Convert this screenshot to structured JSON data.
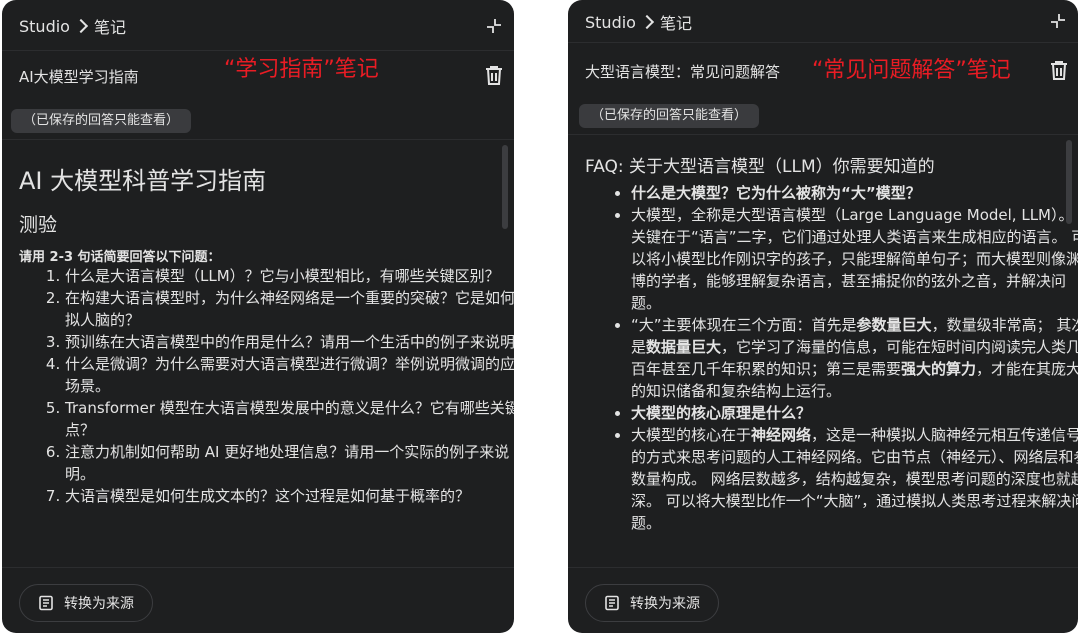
{
  "left": {
    "breadcrumb_root": "Studio",
    "breadcrumb_current": "笔记",
    "note_title": "AI大模型学习指南",
    "annotation": "“学习指南”笔记",
    "chip": "（已保存的回答只能查看）",
    "heading": "AI 大模型科普学习指南",
    "subheading": "测验",
    "instruction": "请用 2-3 句话简要回答以下问题：",
    "questions": [
      "什么是大语言模型（LLM）？它与小模型相比，有哪些关键区别？",
      "在构建大语言模型时，为什么神经网络是一个重要的突破？它是如何模拟人脑的？",
      "预训练在大语言模型中的作用是什么？请用一个生活中的例子来说明。",
      "什么是微调？为什么需要对大语言模型进行微调？举例说明微调的应用场景。",
      "Transformer 模型在大语言模型发展中的意义是什么？它有哪些关键特点？",
      "注意力机制如何帮助 AI 更好地处理信息？请用一个实际的例子来说明。",
      "大语言模型是如何生成文本的？这个过程是如何基于概率的？"
    ],
    "convert_label": "转换为来源"
  },
  "right": {
    "breadcrumb_root": "Studio",
    "breadcrumb_current": "笔记",
    "note_title": "大型语言模型：常见问题解答",
    "annotation": "“常见问题解答”笔记",
    "chip": "（已保存的回答只能查看）",
    "faq_title": "FAQ: 关于大型语言模型（LLM）你需要知道的",
    "q1": "什么是大模型？它为什么被称为“大”模型？",
    "a1": "大模型，全称是大型语言模型（Large Language Model, LLM）。 关键在于“语言”二字，它们通过处理人类语言来生成相应的语言。 可以将小模型比作刚识字的孩子，只能理解简单句子；而大模型则像渊博的学者，能够理解复杂语言，甚至捕捉你的弦外之音，并解决问题。",
    "a2_p1": "“大”主要体现在三个方面：首先是",
    "a2_b1": "参数量巨大",
    "a2_p2": "，数量级非常高； 其次是",
    "a2_b2": "数据量巨大",
    "a2_p3": "，它学习了海量的信息，可能在短时间内阅读完人类几百年甚至几千年积累的知识；第三是需要",
    "a2_b3": "强大的算力",
    "a2_p4": "，才能在其庞大的知识储备和复杂结构上运行。",
    "q2": "大模型的核心原理是什么？",
    "a3_p1": "大模型的核心在于",
    "a3_b1": "神经网络",
    "a3_p2": "，这是一种模拟人脑神经元相互传递信号的方式来思考问题的人工神经网络。它由节点（神经元）、网络层和参数量构成。 网络层数越多，结构越复杂，模型思考问题的深度也就越深。 可以将大模型比作一个“大脑”，通过模拟人类思考过程来解决问题。",
    "convert_label": "转换为来源"
  }
}
